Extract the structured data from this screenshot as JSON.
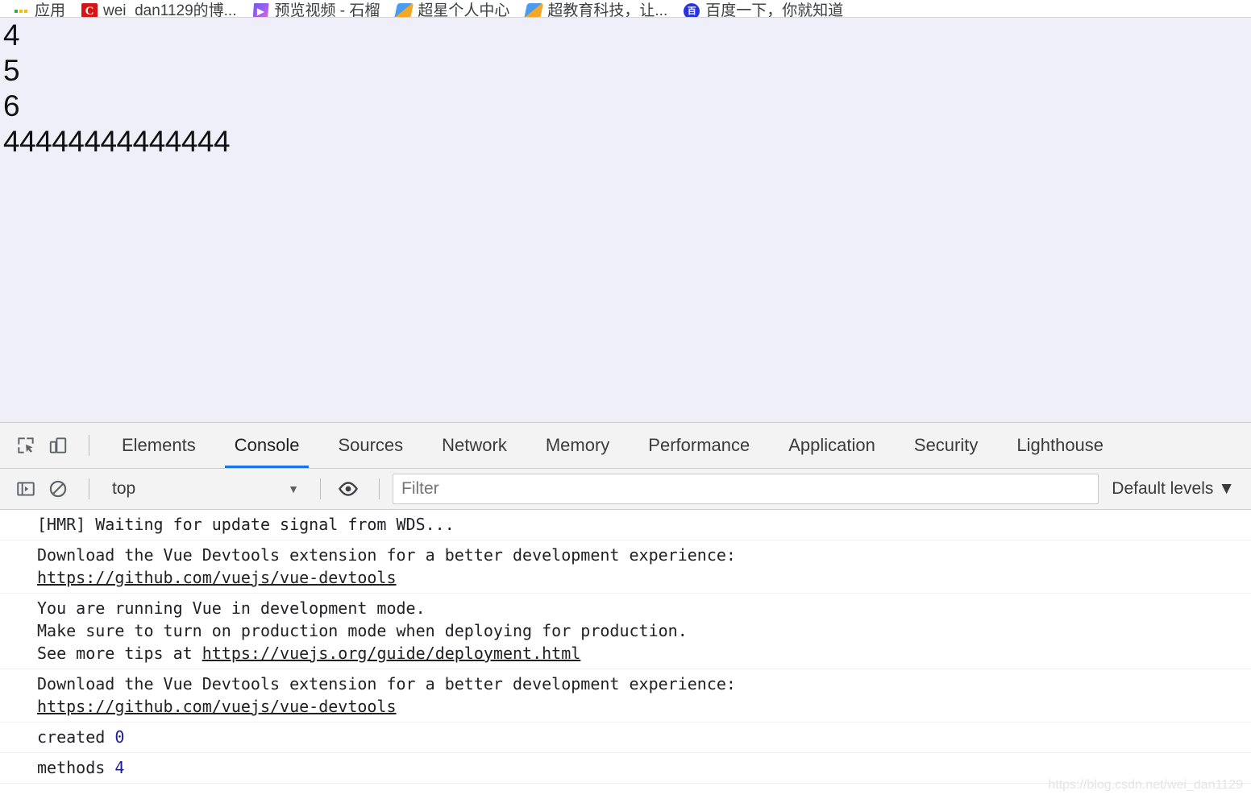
{
  "browser": {
    "bookmarks": [
      {
        "label": "应用",
        "icon": "apps-grid-icon",
        "icon_kind": "apps"
      },
      {
        "label": "wei_dan1129的博...",
        "icon": "csdn-favicon",
        "icon_kind": "csdn",
        "glyph": "C"
      },
      {
        "label": "预览视频 - 石榴",
        "icon": "video-play-favicon",
        "icon_kind": "play",
        "glyph": "▶"
      },
      {
        "label": "超星个人中心",
        "icon": "chaoxing-favicon",
        "icon_kind": "chaoxing",
        "glyph": ""
      },
      {
        "label": "超教育科技，让...",
        "icon": "chaoxing-favicon",
        "icon_kind": "chaoxing",
        "glyph": ""
      },
      {
        "label": "百度一下，你就知道",
        "icon": "baidu-favicon",
        "icon_kind": "baidu",
        "glyph": "百"
      }
    ]
  },
  "page": {
    "background_color": "#eeeff8",
    "lines": [
      "4",
      "5",
      "6",
      "44444444444444"
    ]
  },
  "devtools": {
    "toolbar_icons": [
      {
        "name": "inspect-element-icon",
        "title": "Inspect element"
      },
      {
        "name": "device-toolbar-icon",
        "title": "Toggle device toolbar"
      }
    ],
    "tabs": [
      {
        "label": "Elements",
        "active": false
      },
      {
        "label": "Console",
        "active": true
      },
      {
        "label": "Sources",
        "active": false
      },
      {
        "label": "Network",
        "active": false
      },
      {
        "label": "Memory",
        "active": false
      },
      {
        "label": "Performance",
        "active": false
      },
      {
        "label": "Application",
        "active": false
      },
      {
        "label": "Security",
        "active": false
      },
      {
        "label": "Lighthouse",
        "active": false
      }
    ],
    "active_tab_underline_color": "#1a73e8",
    "console_toolbar": {
      "sidebar_toggle_icon": "console-sidebar-toggle-icon",
      "clear_console_icon": "clear-console-icon",
      "context": "top",
      "context_caret": "▼",
      "eye_icon": "live-expression-eye-icon",
      "filter_placeholder": "Filter",
      "filter_value": "",
      "levels_label": "Default levels",
      "levels_caret": "▼"
    },
    "messages": [
      {
        "name": "console-message-hmr",
        "parts": [
          {
            "type": "text",
            "text": "[HMR] Waiting for update signal from WDS..."
          }
        ]
      },
      {
        "name": "console-message-vue-devtools-1",
        "parts": [
          {
            "type": "text",
            "text": "Download the Vue Devtools extension for a better development experience:\n"
          },
          {
            "type": "link",
            "text": "https://github.com/vuejs/vue-devtools"
          }
        ]
      },
      {
        "name": "console-message-vue-dev-mode",
        "parts": [
          {
            "type": "text",
            "text": "You are running Vue in development mode.\nMake sure to turn on production mode when deploying for production.\nSee more tips at "
          },
          {
            "type": "link",
            "text": "https://vuejs.org/guide/deployment.html"
          }
        ]
      },
      {
        "name": "console-message-vue-devtools-2",
        "parts": [
          {
            "type": "text",
            "text": "Download the Vue Devtools extension for a better development experience:\n"
          },
          {
            "type": "link",
            "text": "https://github.com/vuejs/vue-devtools"
          }
        ]
      },
      {
        "name": "console-message-created",
        "parts": [
          {
            "type": "text",
            "text": "created "
          },
          {
            "type": "number",
            "text": "0"
          }
        ]
      },
      {
        "name": "console-message-methods",
        "parts": [
          {
            "type": "text",
            "text": "methods "
          },
          {
            "type": "number",
            "text": "4"
          }
        ]
      }
    ]
  },
  "watermark": "https://blog.csdn.net/wei_dan1129",
  "colors": {
    "accent": "#1a73e8",
    "number_value": "#1a1aa6",
    "page_bg": "#eeeff8",
    "devtools_bg": "#f3f3f3"
  }
}
